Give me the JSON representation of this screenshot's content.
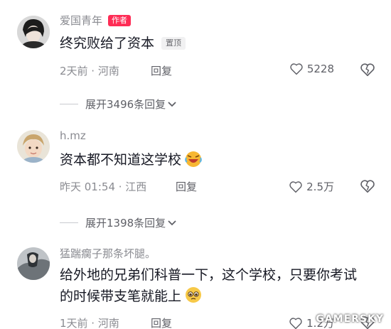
{
  "comments": [
    {
      "username": "爱国青年",
      "badge": "作者",
      "text": "终究败给了资本",
      "pin_label": "置顶",
      "meta": "2天前 · 河南",
      "reply_label": "回复",
      "likes": "5228",
      "expand": "展开3496条回复"
    },
    {
      "username": "h.mz",
      "text": "资本都不知道这学校",
      "meta": "昨天 01:54 · 江西",
      "reply_label": "回复",
      "likes": "2.5万",
      "expand": "展开1398条回复"
    },
    {
      "username": "猛踹瘸子那条坏腿。",
      "text": "给外地的兄弟们科普一下，这个学校，只要你考试的时候带支笔就能上",
      "meta": "1天前 · 河南",
      "reply_label": "回复",
      "likes": "1.2万"
    }
  ],
  "watermark": "GAMERSKY",
  "colors": {
    "author_badge": "#fe2c55",
    "meta_text": "#8a8b91",
    "body_text": "#161823"
  },
  "icons": [
    "heart-outline-icon",
    "broken-heart-icon",
    "chevron-down-icon",
    "emoji-laugh-icon",
    "emoji-pleading-icon"
  ]
}
